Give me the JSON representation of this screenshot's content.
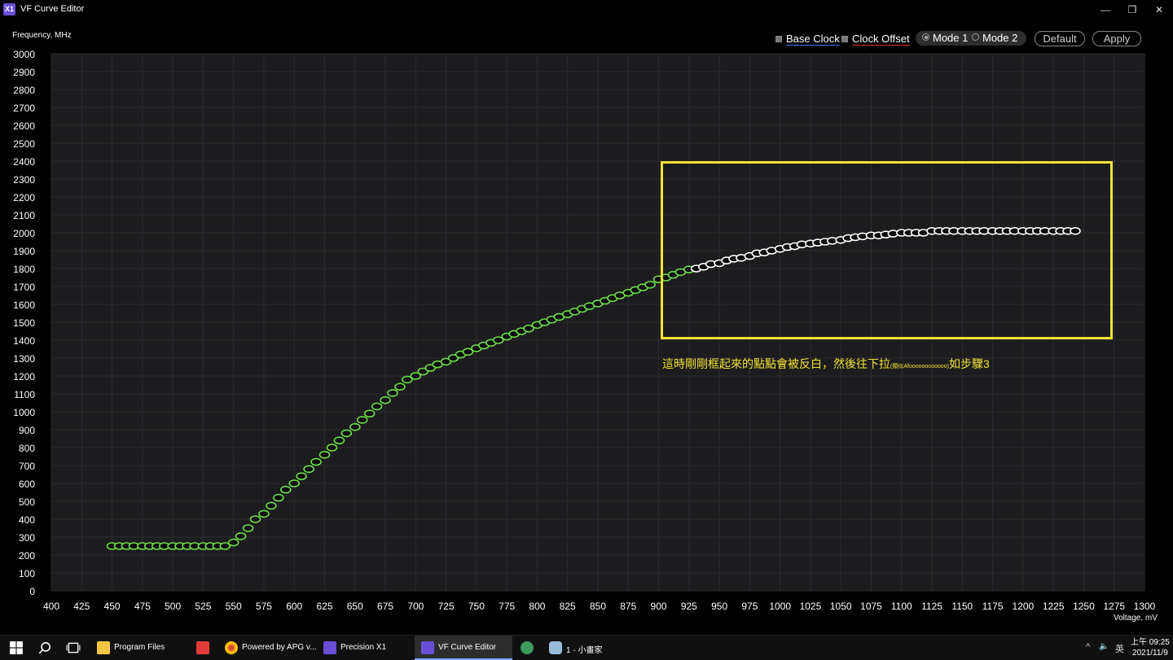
{
  "window": {
    "logo_text": "X1",
    "title": "VF Curve Editor",
    "buttons": {
      "minimize": "—",
      "restore": "❐",
      "close": "✕"
    }
  },
  "controls": {
    "base_clock_label": "Base Clock",
    "clock_offset_label": "Clock Offset",
    "mode1_label": "Mode 1",
    "mode2_label": "Mode 2",
    "mode_selected": "Mode 1",
    "default_label": "Default",
    "apply_label": "Apply"
  },
  "chart_data": {
    "type": "scatter",
    "ylabel": "Frequency, MHz",
    "xlabel": "Voltage, mV",
    "xlim": [
      400,
      1300
    ],
    "ylim": [
      0,
      3000
    ],
    "x_ticks": [
      400,
      425,
      450,
      475,
      500,
      525,
      550,
      575,
      600,
      625,
      650,
      675,
      700,
      725,
      750,
      775,
      800,
      825,
      850,
      875,
      900,
      925,
      950,
      975,
      1000,
      1025,
      1050,
      1075,
      1100,
      1125,
      1150,
      1175,
      1200,
      1225,
      1250,
      1275,
      1300
    ],
    "y_ticks": [
      0,
      100,
      200,
      300,
      400,
      500,
      600,
      700,
      800,
      900,
      1000,
      1100,
      1200,
      1300,
      1400,
      1500,
      1600,
      1700,
      1800,
      1900,
      2000,
      2100,
      2200,
      2300,
      2400,
      2500,
      2600,
      2700,
      2800,
      2900,
      3000
    ],
    "grid": true,
    "colors": {
      "background": "#1c1c1e",
      "grid": "#2c2c30",
      "point_green": "#6fe04a",
      "point_selected": "#ffffff"
    },
    "selected_from_mV": 931,
    "points": [
      [
        450,
        250
      ],
      [
        456,
        250
      ],
      [
        462,
        250
      ],
      [
        468,
        250
      ],
      [
        475,
        250
      ],
      [
        481,
        250
      ],
      [
        487,
        250
      ],
      [
        493,
        250
      ],
      [
        500,
        250
      ],
      [
        506,
        250
      ],
      [
        512,
        250
      ],
      [
        518,
        250
      ],
      [
        525,
        250
      ],
      [
        531,
        250
      ],
      [
        537,
        250
      ],
      [
        543,
        250
      ],
      [
        550,
        270
      ],
      [
        556,
        305
      ],
      [
        562,
        350
      ],
      [
        568,
        400
      ],
      [
        575,
        430
      ],
      [
        581,
        475
      ],
      [
        587,
        520
      ],
      [
        593,
        565
      ],
      [
        600,
        600
      ],
      [
        606,
        640
      ],
      [
        612,
        680
      ],
      [
        618,
        720
      ],
      [
        625,
        760
      ],
      [
        631,
        800
      ],
      [
        637,
        840
      ],
      [
        643,
        880
      ],
      [
        650,
        915
      ],
      [
        656,
        955
      ],
      [
        662,
        990
      ],
      [
        668,
        1030
      ],
      [
        675,
        1065
      ],
      [
        681,
        1105
      ],
      [
        687,
        1140
      ],
      [
        693,
        1180
      ],
      [
        700,
        1200
      ],
      [
        706,
        1225
      ],
      [
        712,
        1245
      ],
      [
        718,
        1265
      ],
      [
        725,
        1280
      ],
      [
        731,
        1300
      ],
      [
        737,
        1320
      ],
      [
        743,
        1335
      ],
      [
        750,
        1355
      ],
      [
        756,
        1370
      ],
      [
        762,
        1385
      ],
      [
        768,
        1400
      ],
      [
        775,
        1420
      ],
      [
        781,
        1435
      ],
      [
        787,
        1450
      ],
      [
        793,
        1465
      ],
      [
        800,
        1485
      ],
      [
        806,
        1500
      ],
      [
        812,
        1515
      ],
      [
        818,
        1530
      ],
      [
        825,
        1545
      ],
      [
        831,
        1560
      ],
      [
        837,
        1575
      ],
      [
        843,
        1590
      ],
      [
        850,
        1605
      ],
      [
        856,
        1620
      ],
      [
        862,
        1635
      ],
      [
        868,
        1650
      ],
      [
        875,
        1665
      ],
      [
        881,
        1680
      ],
      [
        887,
        1695
      ],
      [
        893,
        1710
      ],
      [
        900,
        1740
      ],
      [
        906,
        1750
      ],
      [
        912,
        1765
      ],
      [
        918,
        1780
      ],
      [
        925,
        1795
      ],
      [
        931,
        1800
      ],
      [
        937,
        1810
      ],
      [
        943,
        1825
      ],
      [
        950,
        1830
      ],
      [
        956,
        1845
      ],
      [
        962,
        1855
      ],
      [
        968,
        1860
      ],
      [
        975,
        1870
      ],
      [
        981,
        1885
      ],
      [
        987,
        1890
      ],
      [
        993,
        1900
      ],
      [
        1000,
        1910
      ],
      [
        1006,
        1920
      ],
      [
        1012,
        1925
      ],
      [
        1018,
        1935
      ],
      [
        1025,
        1940
      ],
      [
        1031,
        1945
      ],
      [
        1037,
        1950
      ],
      [
        1043,
        1955
      ],
      [
        1050,
        1960
      ],
      [
        1056,
        1970
      ],
      [
        1062,
        1975
      ],
      [
        1068,
        1980
      ],
      [
        1075,
        1985
      ],
      [
        1081,
        1985
      ],
      [
        1087,
        1990
      ],
      [
        1093,
        1995
      ],
      [
        1100,
        2000
      ],
      [
        1106,
        2000
      ],
      [
        1112,
        2000
      ],
      [
        1118,
        2000
      ],
      [
        1125,
        2010
      ],
      [
        1131,
        2010
      ],
      [
        1137,
        2010
      ],
      [
        1143,
        2010
      ],
      [
        1150,
        2010
      ],
      [
        1156,
        2010
      ],
      [
        1162,
        2010
      ],
      [
        1168,
        2010
      ],
      [
        1175,
        2010
      ],
      [
        1181,
        2010
      ],
      [
        1187,
        2010
      ],
      [
        1193,
        2010
      ],
      [
        1200,
        2010
      ],
      [
        1206,
        2010
      ],
      [
        1212,
        2010
      ],
      [
        1218,
        2010
      ],
      [
        1225,
        2010
      ],
      [
        1231,
        2010
      ],
      [
        1237,
        2010
      ],
      [
        1243,
        2010
      ]
    ]
  },
  "annotation": {
    "text_main": "這時剛剛框起來的點點會被反白，然後往下拉",
    "text_small": "(類似Afoooooooooooo)",
    "text_end": "如步驟3",
    "color": "#f5e334"
  },
  "taskbar": {
    "start_icon": "windows-logo-icon",
    "items": [
      {
        "label": "Program Files"
      },
      {
        "label": ""
      },
      {
        "label": "Powered by APG v..."
      },
      {
        "label": "Precision X1"
      },
      {
        "label": "VF Curve Editor"
      },
      {
        "label": ""
      },
      {
        "label": "1 - 小畫家"
      }
    ],
    "tray": {
      "chevron": "^",
      "speaker": "🔈",
      "ime": "英"
    },
    "clock": {
      "time": "上午 09:25",
      "date": "2021/11/9"
    }
  }
}
